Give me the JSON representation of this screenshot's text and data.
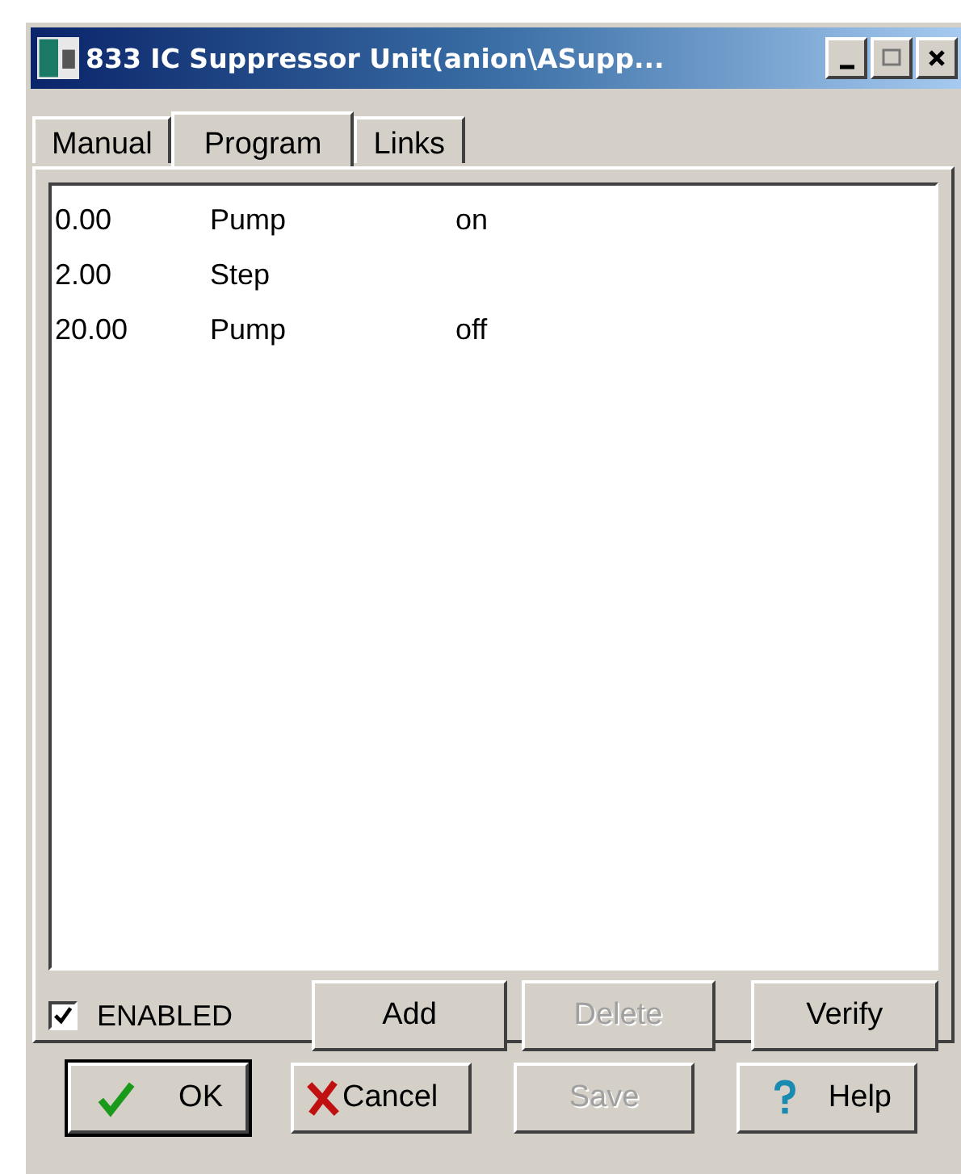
{
  "window": {
    "title": "833 IC Suppressor Unit(anion\\ASupp..."
  },
  "tabs": [
    {
      "label": "Manual",
      "selected": false
    },
    {
      "label": "Program",
      "selected": true
    },
    {
      "label": "Links",
      "selected": false
    }
  ],
  "program": {
    "rows": [
      {
        "time": "0.00",
        "command": "Pump",
        "value": "on"
      },
      {
        "time": "2.00",
        "command": "Step"
      },
      {
        "time": "20.00",
        "command": "Pump",
        "value": "off"
      }
    ]
  },
  "enabled": {
    "label": "ENABLED",
    "checked": true
  },
  "program_buttons": [
    {
      "label": "Add",
      "disabled": false
    },
    {
      "label": "Delete",
      "disabled": true
    },
    {
      "label": "Verify",
      "disabled": false
    }
  ],
  "dialog_buttons": [
    {
      "label": "OK",
      "kind": "check",
      "disabled": false,
      "default": true
    },
    {
      "label": "Cancel",
      "kind": "cross",
      "disabled": false,
      "default": false
    },
    {
      "label": "Save",
      "kind": "plain",
      "disabled": true,
      "default": false
    },
    {
      "label": "Help",
      "kind": "question",
      "disabled": false,
      "default": false
    }
  ]
}
